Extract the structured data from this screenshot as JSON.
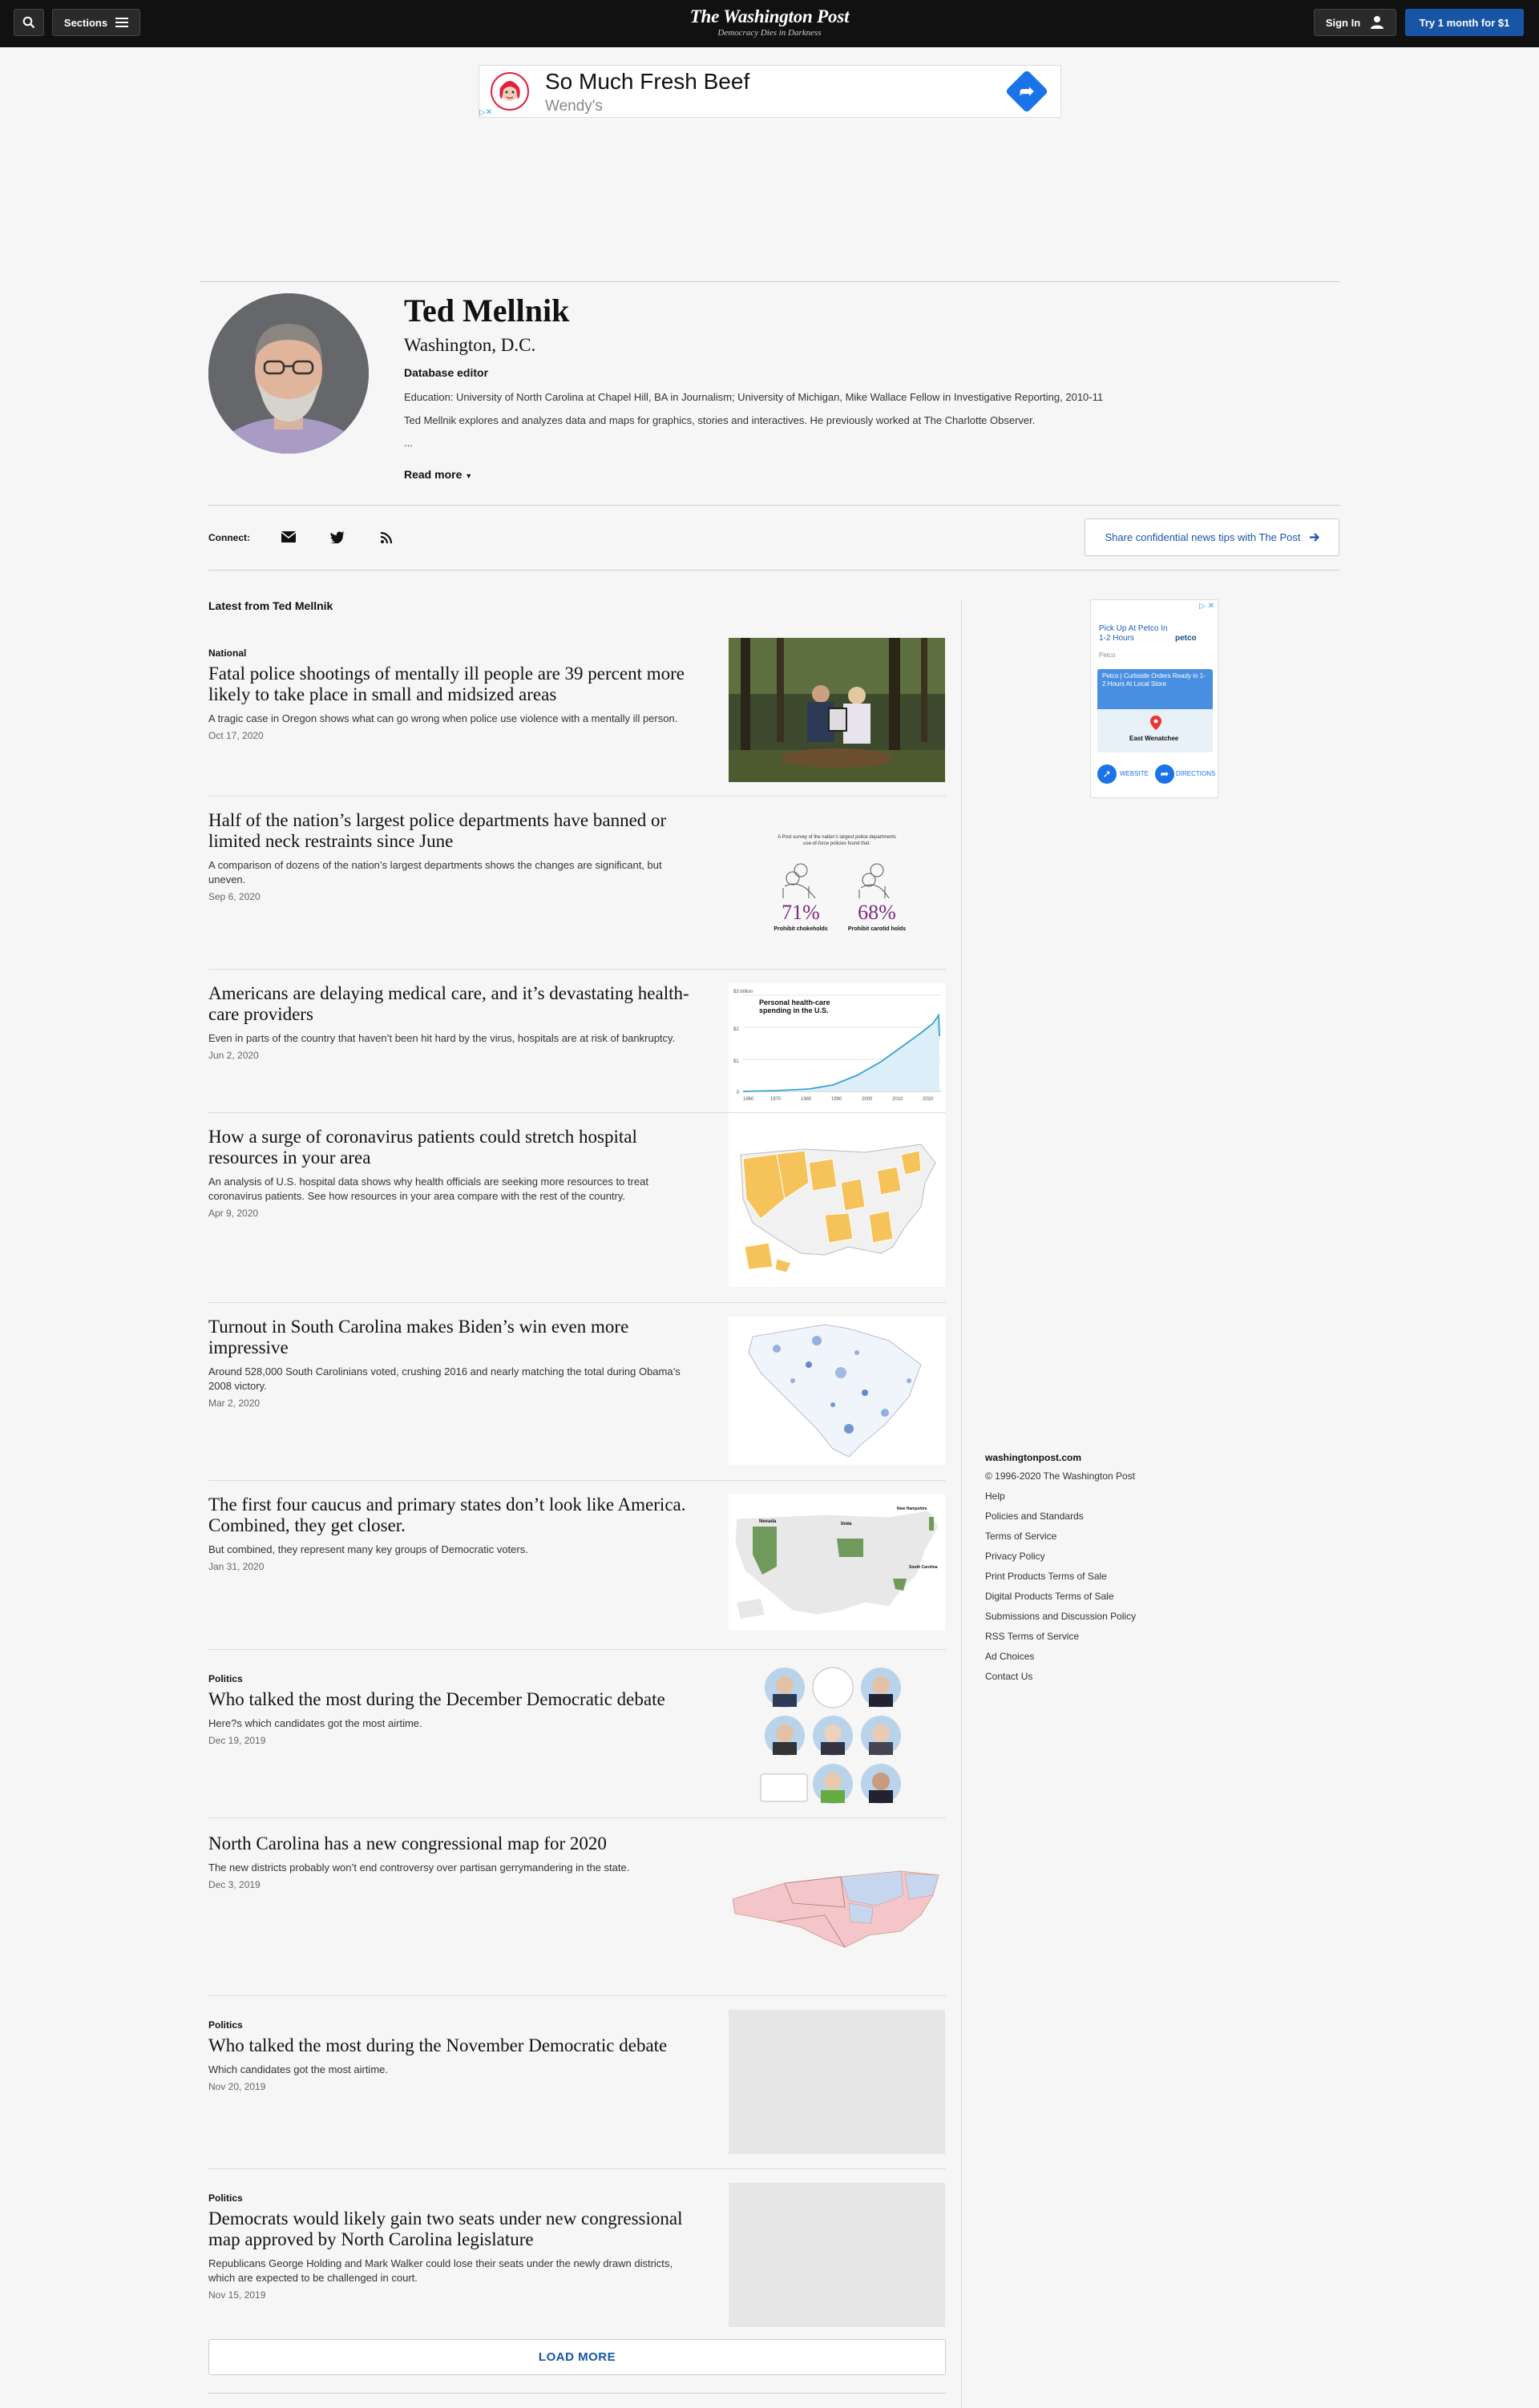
{
  "nav": {
    "sections_label": "Sections",
    "logo_title": "The Washington Post",
    "logo_tagline": "Democracy Dies in Darkness",
    "signin_label": "Sign In",
    "try_label": "Try 1 month for $1"
  },
  "top_ad": {
    "headline": "So Much Fresh Beef",
    "brand": "Wendy's",
    "choice": "▷✕"
  },
  "profile": {
    "name": "Ted Mellnik",
    "location": "Washington, D.C.",
    "role": "Database editor",
    "education": "Education: University of North Carolina at Chapel Hill, BA in Journalism; University of Michigan, Mike Wallace Fellow in Investigative Reporting, 2010-11",
    "bio": "Ted Mellnik explores and analyzes data and maps for graphics, stories and interactives. He previously worked at The Charlotte Observer.",
    "ellipsis": "...",
    "read_more": "Read more"
  },
  "connect": {
    "label": "Connect:",
    "icons": [
      "envelope-icon",
      "twitter-icon",
      "rss-icon"
    ],
    "tips_label": "Share confidential news tips with The Post"
  },
  "latest_label": "Latest from Ted Mellnik",
  "articles": [
    {
      "kicker": "National",
      "headline": "Fatal police shootings of mentally ill people are 39 percent more likely to take place in small and midsized areas",
      "blurb": "A tragic case in Oregon shows what can go wrong when police use violence with a mentally ill person.",
      "date": "Oct 17, 2020"
    },
    {
      "kicker": "",
      "headline": "Half of the nation’s largest police departments have banned or limited neck restraints since June",
      "blurb": "A comparison of dozens of the nation’s largest departments shows the changes are significant, but uneven.",
      "date": "Sep 6, 2020",
      "thumb_caption": "A Post survey of the nation's largest police departments use-of-force policies found that:",
      "thumb_stat1": "71%",
      "thumb_stat1_label": "Prohibit chokeholds",
      "thumb_stat2": "68%",
      "thumb_stat2_label": "Prohibit carotid holds"
    },
    {
      "kicker": "",
      "headline": "Americans are delaying medical care, and it’s devastating health-care providers",
      "blurb": "Even in parts of the country that haven’t been hit hard by the virus, hospitals are at risk of bankruptcy.",
      "date": "Jun 2, 2020",
      "thumb_title": "Personal health-care spending in the U.S.",
      "thumb_axis_top": "$3 trillion"
    },
    {
      "kicker": "",
      "headline": "How a surge of coronavirus patients could stretch hospital resources in your area",
      "blurb": "An analysis of U.S. hospital data shows why health officials are seeking more resources to treat coronavirus patients. See how resources in your area compare with the rest of the country.",
      "date": "Apr 9, 2020"
    },
    {
      "kicker": "",
      "headline": "Turnout in South Carolina makes Biden’s win even more impressive",
      "blurb": "Around 528,000 South Carolinians voted, crushing 2016 and nearly matching the total during Obama’s 2008 victory.",
      "date": "Mar 2, 2020"
    },
    {
      "kicker": "",
      "headline": "The first four caucus and primary states don’t look like America. Combined, they get closer.",
      "blurb": "But combined, they represent many key groups of Democratic voters.",
      "date": "Jan 31, 2020",
      "thumb_label_nv": "Nevada",
      "thumb_label_ia": "Iowa",
      "thumb_label_nh": "New Hampshire",
      "thumb_label_sc": "South Carolina"
    },
    {
      "kicker": "Politics",
      "headline": "Who talked the most during the December Democratic debate",
      "blurb": "Here?s which candidates got the most airtime.",
      "date": "Dec 19, 2019"
    },
    {
      "kicker": "",
      "headline": "North Carolina has a new congressional map for 2020",
      "blurb": "The new districts probably won’t end controversy over partisan gerrymandering in the state.",
      "date": "Dec 3, 2019"
    },
    {
      "kicker": "Politics",
      "headline": "Who talked the most during the November Democratic debate",
      "blurb": "Which candidates got the most airtime.",
      "date": "Nov 20, 2019"
    },
    {
      "kicker": "Politics",
      "headline": "Democrats would likely gain two seats under new congressional map approved by North Carolina legislature",
      "blurb": "Republicans George Holding and Mark Walker could lose their seats under the newly drawn districts, which are expected to be challenged in court.",
      "date": "Nov 15, 2019"
    }
  ],
  "side_ad": {
    "headline": "Pick Up At Petco In 1-2 Hours",
    "brand_logo": "petco",
    "brand": "Petco",
    "card_text": "Petco | Curbside Orders Ready in 1-2 Hours At Local Store",
    "location": "East Wenatchee",
    "website_label": "WEBSITE",
    "directions_label": "DIRECTIONS"
  },
  "footer": {
    "site": "washingtonpost.com",
    "copyright": "© 1996-2020 The Washington Post",
    "links": [
      "Help",
      "Policies and Standards",
      "Terms of Service",
      "Privacy Policy",
      "Print Products Terms of Sale",
      "Digital Products Terms of Sale",
      "Submissions and Discussion Policy",
      "RSS Terms of Service",
      "Ad Choices",
      "Contact Us"
    ]
  },
  "load_more": "LOAD MORE",
  "colors": {
    "nav_bg": "#111111",
    "accent_blue": "#1955a5",
    "page_bg": "#f6f6f6",
    "map_yellow": "#f6c35b",
    "map_green": "#6f9a5b",
    "stat_purple": "#7a2d7f"
  }
}
